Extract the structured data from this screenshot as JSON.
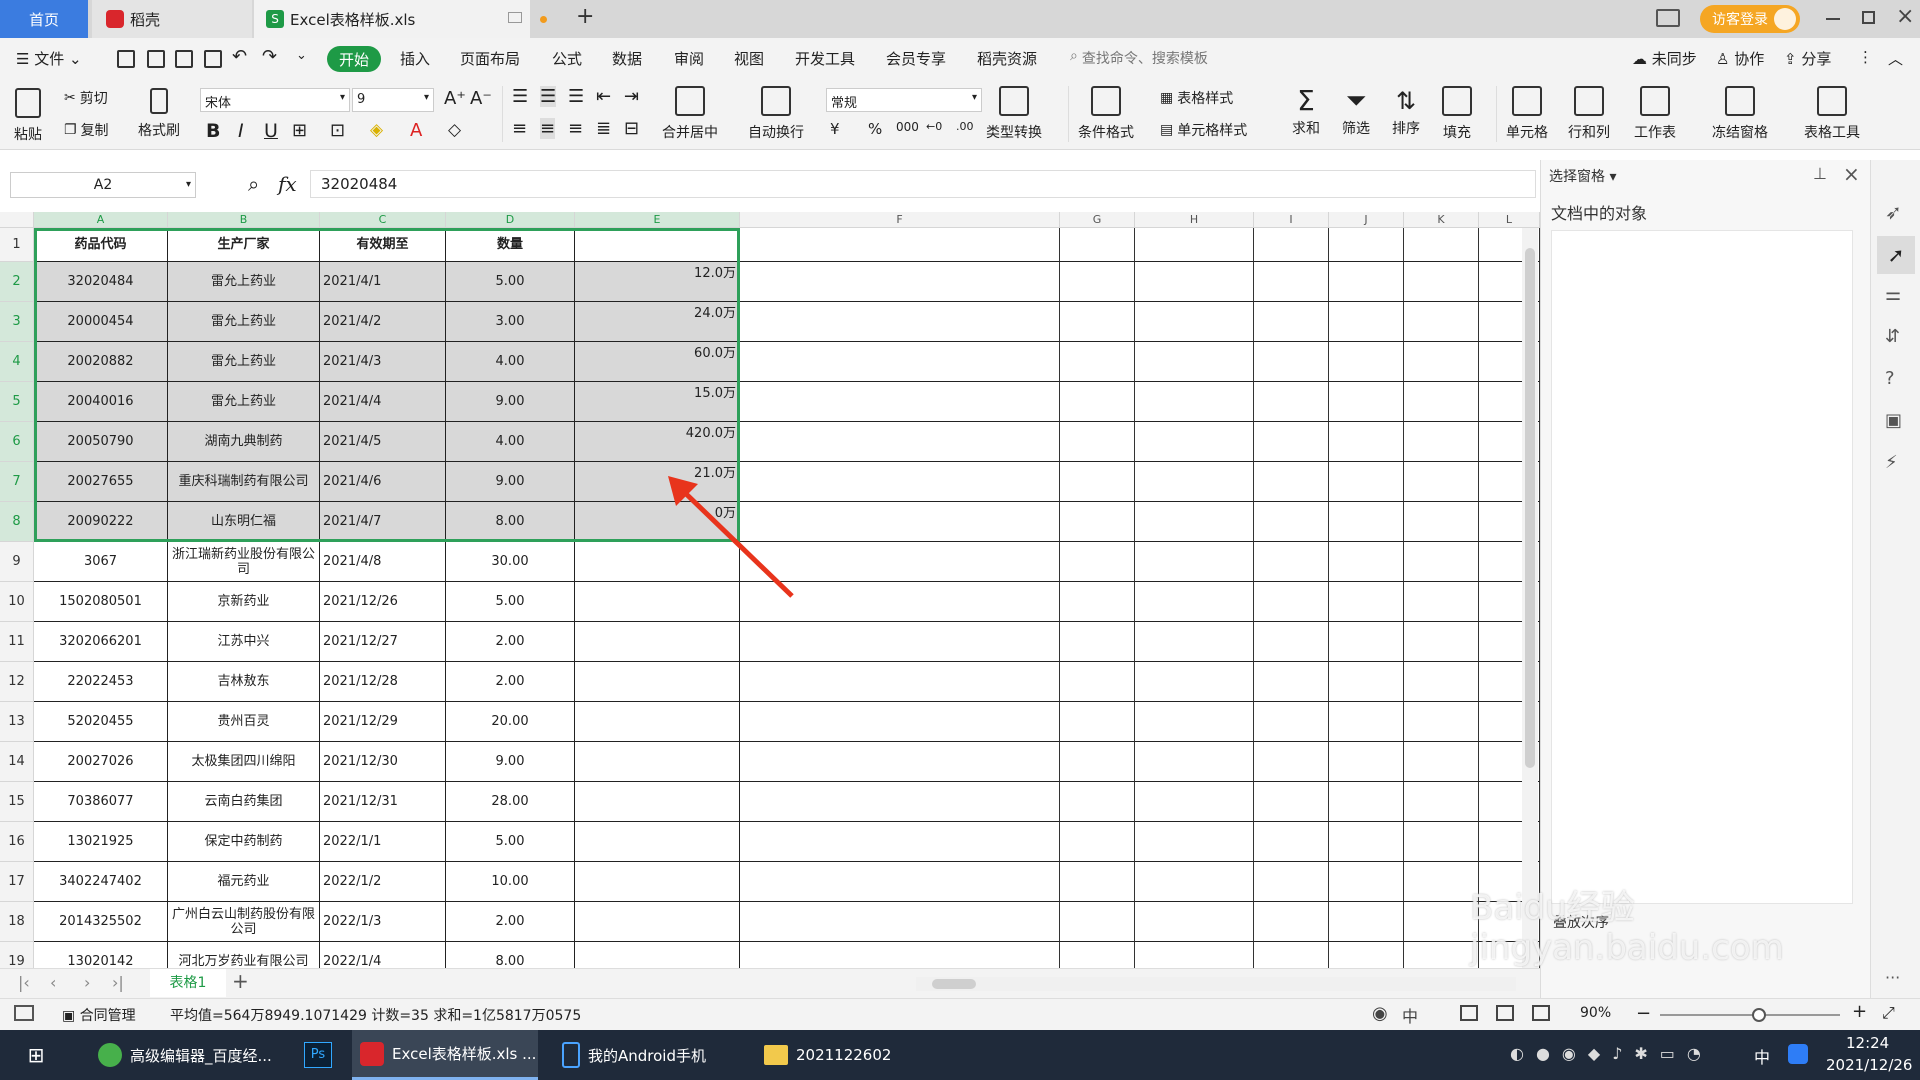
{
  "tabs": {
    "home": "首页",
    "daoke": "稻壳",
    "file": "Excel表格样板.xls",
    "new_tab": "+",
    "login": "访客登录"
  },
  "menu": {
    "file": "文件",
    "items": [
      "开始",
      "插入",
      "页面布局",
      "公式",
      "数据",
      "审阅",
      "视图",
      "开发工具",
      "会员专享",
      "稻壳资源"
    ],
    "search_placeholder": "查找命令、搜索模板",
    "sync": "未同步",
    "collab": "协作",
    "share": "分享"
  },
  "ribbon": {
    "paste": "粘贴",
    "cut": "剪切",
    "copy": "复制",
    "format_painter": "格式刷",
    "font_name": "宋体",
    "font_size": "9",
    "merge_center": "合并居中",
    "wrap": "自动换行",
    "number_format": "常规",
    "type_convert": "类型转换",
    "cond_format": "条件格式",
    "table_style": "表格样式",
    "cell_style": "单元格样式",
    "sum": "求和",
    "filter": "筛选",
    "sort": "排序",
    "fill": "填充",
    "cell": "单元格",
    "rowcol": "行和列",
    "worksheet": "工作表",
    "freeze": "冻结窗格",
    "table_tools": "表格工具"
  },
  "formula_bar": {
    "name_box": "A2",
    "fx": "fx",
    "value": "32020484"
  },
  "columns": [
    "A",
    "B",
    "C",
    "D",
    "E",
    "F",
    "G",
    "H",
    "I",
    "J",
    "K",
    "L"
  ],
  "header_row": [
    "药品代码",
    "生产厂家",
    "有效期至",
    "数量",
    ""
  ],
  "rows": [
    {
      "n": "2",
      "a": "32020484",
      "b": "雷允上药业",
      "c": "2021/4/1",
      "d": "5.00",
      "e": "12.0万"
    },
    {
      "n": "3",
      "a": "20000454",
      "b": "雷允上药业",
      "c": "2021/4/2",
      "d": "3.00",
      "e": "24.0万"
    },
    {
      "n": "4",
      "a": "20020882",
      "b": "雷允上药业",
      "c": "2021/4/3",
      "d": "4.00",
      "e": "60.0万"
    },
    {
      "n": "5",
      "a": "20040016",
      "b": "雷允上药业",
      "c": "2021/4/4",
      "d": "9.00",
      "e": "15.0万"
    },
    {
      "n": "6",
      "a": "20050790",
      "b": "湖南九典制药",
      "c": "2021/4/5",
      "d": "4.00",
      "e": "420.0万"
    },
    {
      "n": "7",
      "a": "20027655",
      "b": "重庆科瑞制药有限公司",
      "c": "2021/4/6",
      "d": "9.00",
      "e": "21.0万"
    },
    {
      "n": "8",
      "a": "20090222",
      "b": "山东明仁福",
      "c": "2021/4/7",
      "d": "8.00",
      "e": "0万"
    },
    {
      "n": "9",
      "a": "3067",
      "b": "浙江瑞新药业股份有限公司",
      "c": "2021/4/8",
      "d": "30.00",
      "e": ""
    },
    {
      "n": "10",
      "a": "1502080501",
      "b": "京新药业",
      "c": "2021/12/26",
      "d": "5.00",
      "e": ""
    },
    {
      "n": "11",
      "a": "3202066201",
      "b": "江苏中兴",
      "c": "2021/12/27",
      "d": "2.00",
      "e": ""
    },
    {
      "n": "12",
      "a": "22022453",
      "b": "吉林敖东",
      "c": "2021/12/28",
      "d": "2.00",
      "e": ""
    },
    {
      "n": "13",
      "a": "52020455",
      "b": "贵州百灵",
      "c": "2021/12/29",
      "d": "20.00",
      "e": ""
    },
    {
      "n": "14",
      "a": "20027026",
      "b": "太极集团四川绵阳",
      "c": "2021/12/30",
      "d": "9.00",
      "e": ""
    },
    {
      "n": "15",
      "a": "70386077",
      "b": "云南白药集团",
      "c": "2021/12/31",
      "d": "28.00",
      "e": ""
    },
    {
      "n": "16",
      "a": "13021925",
      "b": "保定中药制药",
      "c": "2022/1/1",
      "d": "5.00",
      "e": ""
    },
    {
      "n": "17",
      "a": "3402247402",
      "b": "福元药业",
      "c": "2022/1/2",
      "d": "10.00",
      "e": ""
    },
    {
      "n": "18",
      "a": "2014325502",
      "b": "广州白云山制药股份有限公司",
      "c": "2022/1/3",
      "d": "2.00",
      "e": ""
    },
    {
      "n": "19",
      "a": "13020142",
      "b": "河北万岁药业有限公司",
      "c": "2022/1/4",
      "d": "8.00",
      "e": ""
    }
  ],
  "side_panel": {
    "title": "选择窗格",
    "subtitle": "文档中的对象",
    "order": "叠放次序"
  },
  "sheet_tab": "表格1",
  "status": {
    "contract": "合同管理",
    "stats": "平均值=564万8949.1071429  计数=35  求和=1亿5817万0575",
    "zoom": "90%"
  },
  "taskbar": {
    "items": [
      "高级编辑器_百度经...",
      "Ps",
      "Excel表格样板.xls ...",
      "我的Android手机",
      "2021122602"
    ],
    "ime": "中",
    "time": "12:24",
    "date": "2021/12/26"
  },
  "watermark": "Baidu经验 jingyan.baidu.com",
  "colors": {
    "accent": "#1e9a46",
    "tab_blue": "#3b7ce0",
    "selection": "#2ea05a",
    "arrow": "#e8341c"
  }
}
